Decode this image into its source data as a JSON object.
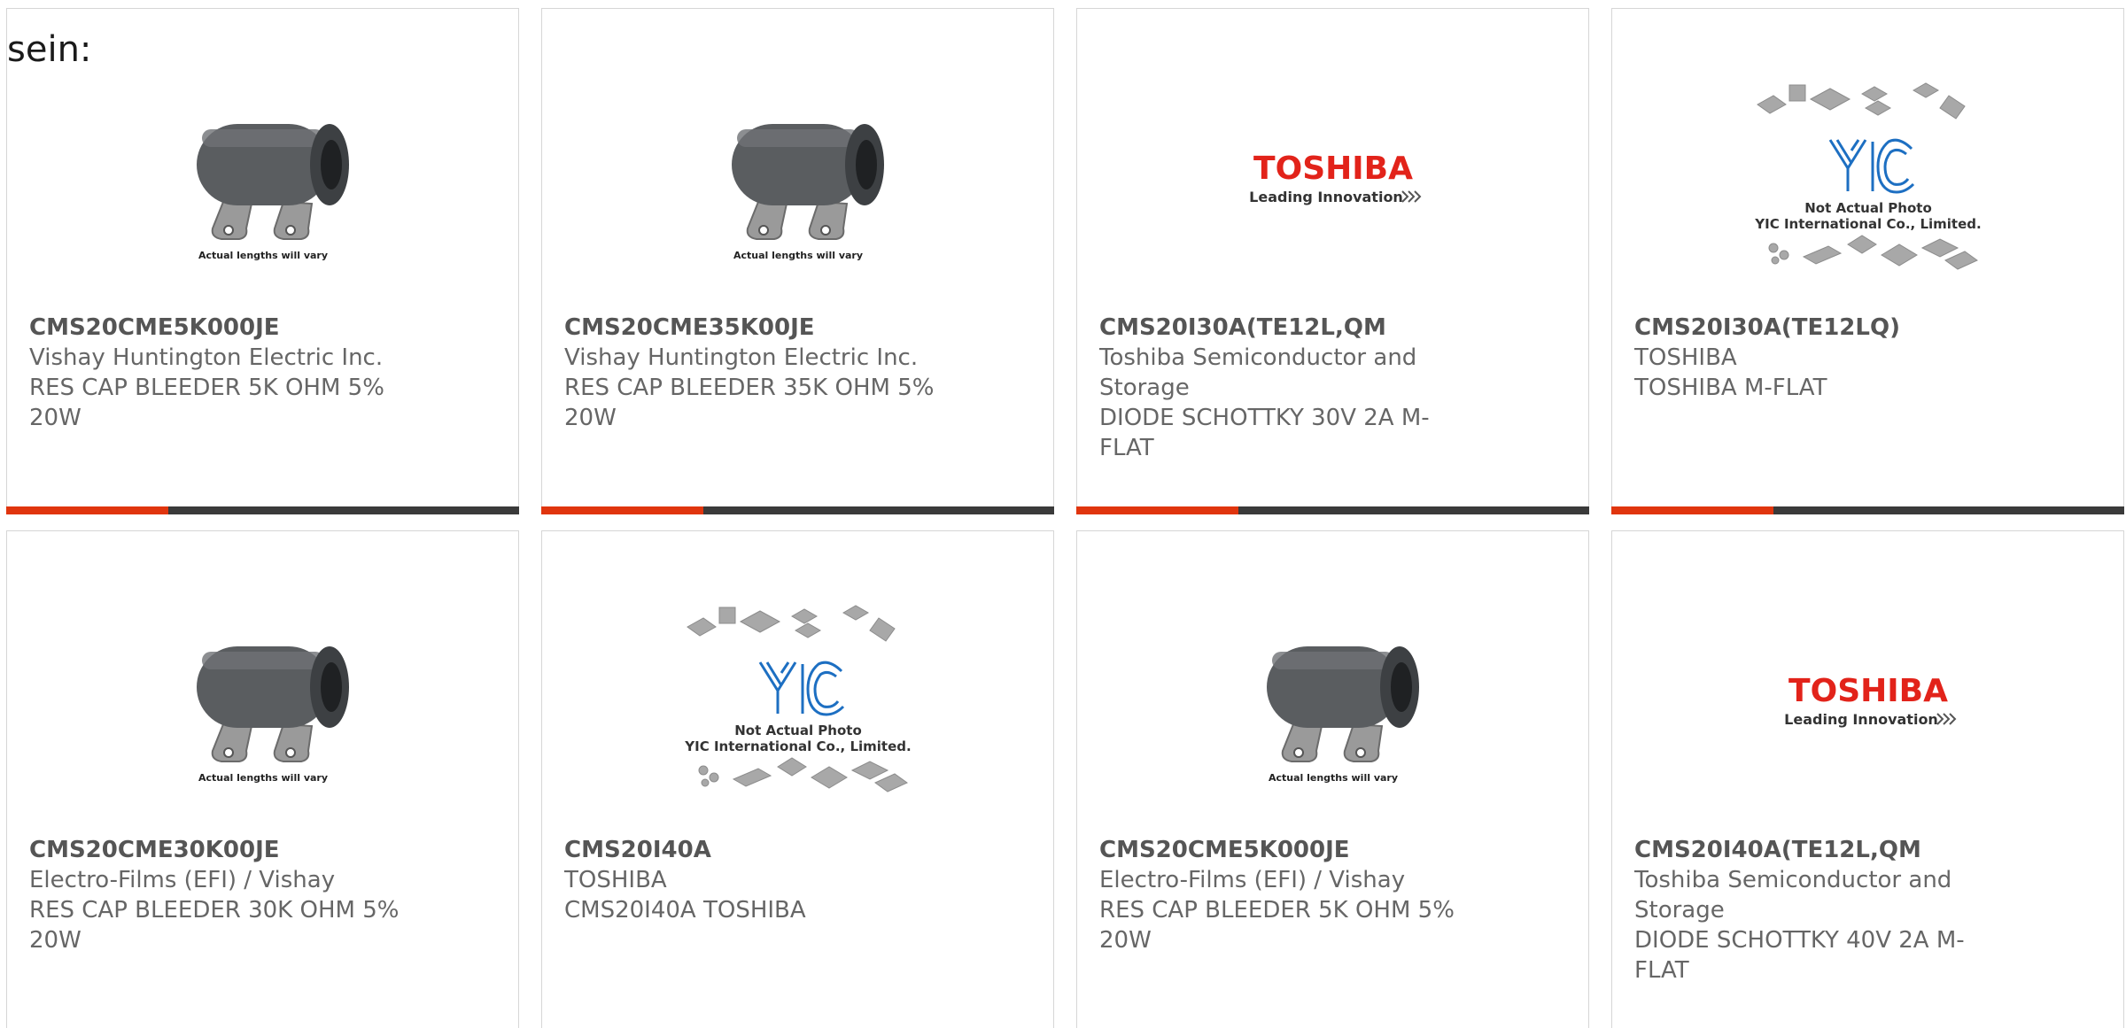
{
  "intro": {
    "text": "sein:"
  },
  "image_captions": {
    "resistor": "Actual lengths will vary",
    "toshiba_brand": "TOSHIBA",
    "toshiba_slogan": "Leading Innovation",
    "yic_logo": "YIC",
    "yic_line1": "Not Actual Photo",
    "yic_line2": "YIC International Co., Limited."
  },
  "colors": {
    "accent": "#e0350e",
    "bar": "#3a3a3a",
    "text": "#666666",
    "toshiba_red": "#e2231a",
    "yic_blue": "#1d6fc2"
  },
  "products": [
    {
      "image": "resistor-photo",
      "part_no": "CMS20CME5K000JE",
      "manufacturer": "Vishay Huntington Electric Inc.",
      "description": "RES CAP BLEEDER 5K OHM 5% 20W"
    },
    {
      "image": "resistor-photo",
      "part_no": "CMS20CME35K00JE",
      "manufacturer": "Vishay Huntington Electric Inc.",
      "description": "RES CAP BLEEDER 35K OHM 5% 20W"
    },
    {
      "image": "toshiba-logo",
      "part_no": "CMS20I30A(TE12L,QM",
      "manufacturer": "Toshiba Semiconductor and Storage",
      "description": "DIODE SCHOTTKY 30V 2A M-FLAT"
    },
    {
      "image": "yic-placeholder",
      "part_no": "CMS20I30A(TE12LQ)",
      "manufacturer": "TOSHIBA",
      "description": "TOSHIBA M-FLAT"
    },
    {
      "image": "resistor-photo",
      "part_no": "CMS20CME30K00JE",
      "manufacturer": "Electro-Films (EFI) / Vishay",
      "description": "RES CAP BLEEDER 30K OHM 5% 20W"
    },
    {
      "image": "yic-placeholder",
      "part_no": "CMS20I40A",
      "manufacturer": "TOSHIBA",
      "description": "CMS20I40A TOSHIBA"
    },
    {
      "image": "resistor-photo",
      "part_no": "CMS20CME5K000JE",
      "manufacturer": "Electro-Films (EFI) / Vishay",
      "description": "RES CAP BLEEDER 5K OHM 5% 20W"
    },
    {
      "image": "toshiba-logo",
      "part_no": "CMS20I40A(TE12L,QM",
      "manufacturer": "Toshiba Semiconductor and Storage",
      "description": "DIODE SCHOTTKY 40V 2A M-FLAT"
    }
  ]
}
